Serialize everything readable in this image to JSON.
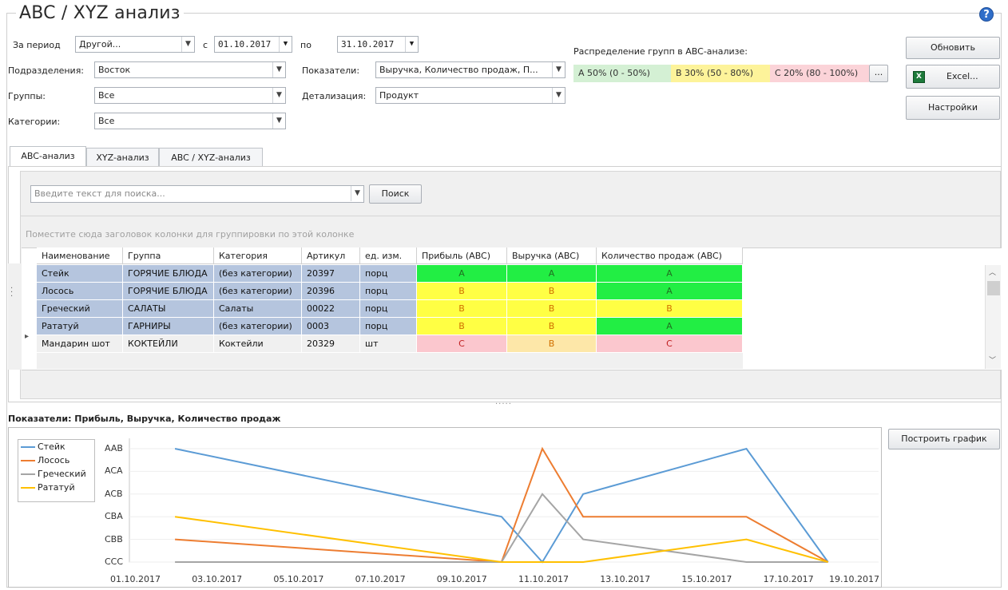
{
  "title": "ABC / XYZ анализ",
  "help_glyph": "?",
  "filters": {
    "period_label": "За период",
    "period_value": "Другой...",
    "from_label": "с",
    "from_value": "01.10.2017",
    "to_label": "по",
    "to_value": "31.10.2017",
    "departments_label": "Подразделения:",
    "departments_value": "Восток",
    "groups_label": "Группы:",
    "groups_value": "Все",
    "categories_label": "Категории:",
    "categories_value": "Все",
    "indicators_label": "Показатели:",
    "indicators_value": "Выручка, Количество продаж, П...",
    "detail_label": "Детализация:",
    "detail_value": "Продукт"
  },
  "distribution": {
    "label": "Распределение групп в ABC-анализе:",
    "a": "A 50% (0 - 50%)",
    "b": "B 30% (50 - 80%)",
    "c": "C 20% (80 - 100%)",
    "more": "...",
    "a_color": "#d4f0d4",
    "b_color": "#fdf39a",
    "c_color": "#fbd3d8"
  },
  "buttons": {
    "refresh": "Обновить",
    "excel": "Excel...",
    "settings": "Настройки",
    "search": "Поиск",
    "build_chart": "Построить график"
  },
  "tabs": [
    "ABC-анализ",
    "XYZ-анализ",
    "ABC / XYZ-анализ"
  ],
  "search": {
    "placeholder": "Введите текст для поиска..."
  },
  "group_hint": "Поместите сюда заголовок колонки для группировки по этой колонке",
  "table": {
    "columns": [
      "Наименование",
      "Группа",
      "Категория",
      "Артикул",
      "ед. изм.",
      "Прибыль (ABC)",
      "Выручка (ABC)",
      "Количество продаж (ABC)"
    ],
    "rows": [
      [
        "Стейк",
        "ГОРЯЧИЕ БЛЮДА",
        "(без категории)",
        "20397",
        "порц",
        "A",
        "A",
        "A"
      ],
      [
        "Лосось",
        "ГОРЯЧИЕ БЛЮДА",
        "(без категории)",
        "20396",
        "порц",
        "B",
        "B",
        "A"
      ],
      [
        "Греческий",
        "САЛАТЫ",
        "Салаты",
        "00022",
        "порц",
        "B",
        "B",
        "B"
      ],
      [
        "Рататуй",
        "ГАРНИРЫ",
        "(без категории)",
        "0003",
        "порц",
        "B",
        "B",
        "A"
      ],
      [
        "Мандарин шот",
        "КОКТЕЙЛИ",
        "Коктейли",
        "20329",
        "шт",
        "C",
        "B",
        "C"
      ]
    ],
    "current_row_marker": "▸",
    "splitter": "....."
  },
  "chart_caption": "Показатели: Прибыль, Выручка, Количество продаж",
  "colors": {
    "selected_row": "#b5c5de",
    "grade_a": "#22ee44",
    "grade_b": "#ffff44",
    "grade_c": "#fbc7ce",
    "grade_b_light": "#fde7a8",
    "grade_a_text": "#207020",
    "grade_b_text": "#d07000",
    "grade_c_text": "#c02020"
  },
  "chart_data": {
    "type": "line",
    "y_categories": [
      "CCC",
      "CBB",
      "CBA",
      "ACB",
      "ACA",
      "AAB"
    ],
    "x_ticks": [
      "01.10.2017",
      "03.10.2017",
      "05.10.2017",
      "07.10.2017",
      "09.10.2017",
      "11.10.2017",
      "13.10.2017",
      "15.10.2017",
      "17.10.2017",
      "19.10.2017"
    ],
    "grid": true,
    "legend": "top-left",
    "series": [
      {
        "name": "Стейк",
        "color": "#5b9bd5",
        "points": [
          [
            "02.10.2017",
            "AAB"
          ],
          [
            "10.10.2017",
            "CBA"
          ],
          [
            "11.10.2017",
            "CCC"
          ],
          [
            "12.10.2017",
            "ACB"
          ],
          [
            "16.10.2017",
            "AAB"
          ],
          [
            "18.10.2017",
            "CCC"
          ]
        ]
      },
      {
        "name": "Лосось",
        "color": "#ed7d31",
        "points": [
          [
            "02.10.2017",
            "CBB"
          ],
          [
            "10.10.2017",
            "CCC"
          ],
          [
            "11.10.2017",
            "AAB"
          ],
          [
            "12.10.2017",
            "CBA"
          ],
          [
            "16.10.2017",
            "CBA"
          ],
          [
            "18.10.2017",
            "CCC"
          ]
        ]
      },
      {
        "name": "Греческий",
        "color": "#a5a5a5",
        "points": [
          [
            "02.10.2017",
            "CCC"
          ],
          [
            "10.10.2017",
            "CCC"
          ],
          [
            "11.10.2017",
            "ACB"
          ],
          [
            "12.10.2017",
            "CBB"
          ],
          [
            "16.10.2017",
            "CCC"
          ],
          [
            "18.10.2017",
            "CCC"
          ]
        ]
      },
      {
        "name": "Рататуй",
        "color": "#ffc000",
        "points": [
          [
            "02.10.2017",
            "CBA"
          ],
          [
            "10.10.2017",
            "CCC"
          ],
          [
            "11.10.2017",
            "CCC"
          ],
          [
            "12.10.2017",
            "CCC"
          ],
          [
            "16.10.2017",
            "CBB"
          ],
          [
            "18.10.2017",
            "CCC"
          ]
        ]
      }
    ]
  }
}
